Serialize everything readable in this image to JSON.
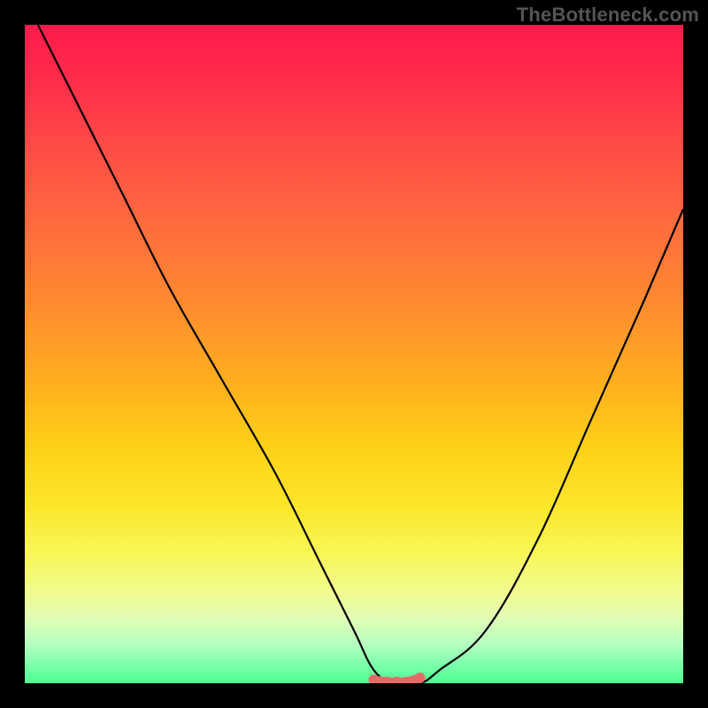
{
  "watermark": "TheBottleneck.com",
  "chart_data": {
    "type": "line",
    "title": "",
    "xlabel": "",
    "ylabel": "",
    "xlim": [
      0,
      100
    ],
    "ylim": [
      0,
      100
    ],
    "grid": false,
    "series": [
      {
        "name": "bottleneck-curve",
        "x": [
          2,
          8,
          15,
          22,
          30,
          38,
          45,
          50,
          53,
          56,
          60,
          63,
          70,
          78,
          86,
          94,
          100
        ],
        "values": [
          100,
          88,
          74,
          60,
          46,
          32,
          18,
          8,
          2,
          0,
          0,
          2,
          8,
          22,
          40,
          58,
          72
        ]
      }
    ],
    "valley_markers_x": [
      53,
      55,
      56.5,
      58,
      60
    ],
    "valley_markers_y": [
      0.5,
      0.2,
      0.2,
      0.2,
      0.8
    ],
    "gradient_stops": [
      {
        "pos": 0,
        "color": "#ff1a4d"
      },
      {
        "pos": 50,
        "color": "#ffae1e"
      },
      {
        "pos": 80,
        "color": "#f8f655"
      },
      {
        "pos": 100,
        "color": "#4dff92"
      }
    ]
  }
}
